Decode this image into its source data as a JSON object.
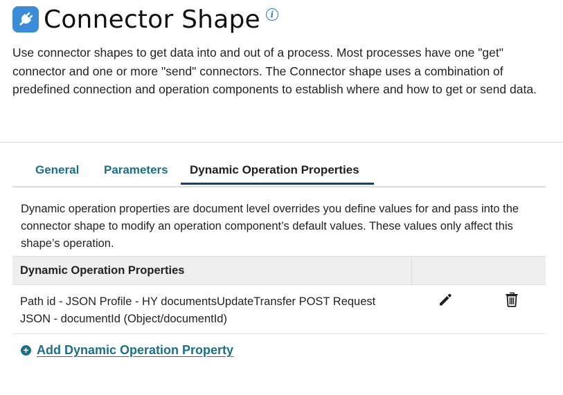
{
  "header": {
    "title": "Connector Shape",
    "info_icon": "info-icon",
    "shape_icon": "plug-icon",
    "accent_color": "#3c8dd8"
  },
  "intro": "Use connector shapes to get data into and out of a process. Most processes have one \"get\" connector and one or more \"send\" connectors. The Connector shape uses a combination of predefined connection and operation components to establish where and how to get or send data.",
  "tabs": [
    {
      "label": "General",
      "active": false
    },
    {
      "label": "Parameters",
      "active": false
    },
    {
      "label": "Dynamic Operation Properties",
      "active": true
    }
  ],
  "description": "Dynamic operation properties are document level overrides you define values for and pass into the connector shape to modify an operation component’s default values. These values only affect this shape’s operation.",
  "table": {
    "header": "Dynamic Operation Properties",
    "rows": [
      {
        "label": "Path id - JSON Profile - HY documentsUpdateTransfer POST Request JSON - documentId (Object/documentId)",
        "actions": [
          "pencil-icon",
          "trash-icon"
        ]
      }
    ]
  },
  "add_link": {
    "label": "Add Dynamic Operation Property",
    "icon": "plus-circle-icon",
    "color": "#1b6f86"
  }
}
